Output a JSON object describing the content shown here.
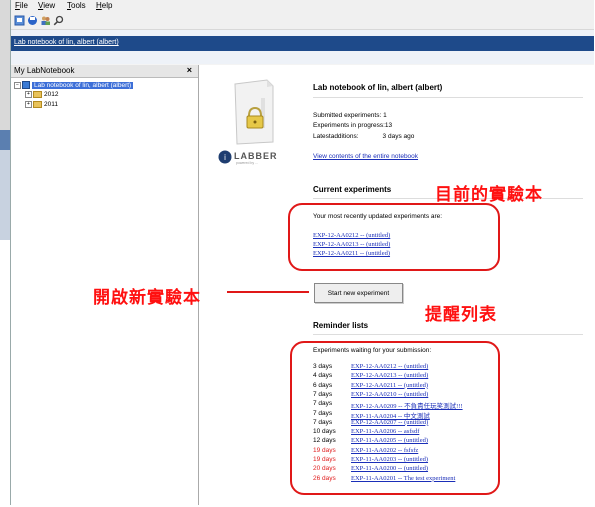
{
  "menu": [
    "File",
    "View",
    "Tools",
    "Help"
  ],
  "toolbar_icons": [
    "new-icon",
    "save-icon",
    "users-icon",
    "search-icon"
  ],
  "breadcrumb": "Lab notebook of lin, albert (albert)",
  "left_panel": {
    "title": "My LabNotebook",
    "close": "×",
    "tree": {
      "root": "Lab notebook of lin, albert (albert)",
      "children": [
        "2012",
        "2011"
      ]
    }
  },
  "main": {
    "title": "Lab notebook of lin, albert (albert)",
    "logo_text": "LABBER",
    "logo_sub": "powered by ...",
    "stats": [
      {
        "label": "Submitted experiments:",
        "value": "1"
      },
      {
        "label": "Experiments in progress:",
        "value": "13"
      },
      {
        "label": "Latestadditions:",
        "value": "3 days ago"
      }
    ],
    "view_link": "View contents of the entire notebook",
    "current": {
      "heading": "Current experiments",
      "intro": "Your most recently updated experiments are:",
      "items": [
        "EXP-12-AA0212 -- (untitled)",
        "EXP-12-AA0213 -- (untitled)",
        "EXP-12-AA0211 -- (untitled)"
      ]
    },
    "start_button": "Start new experiment",
    "reminder": {
      "heading": "Reminder lists",
      "intro": "Experiments waiting for your submission:",
      "items": [
        {
          "days": "3 days",
          "link": "EXP-12-AA0212 -- (untitled)",
          "overdue": false
        },
        {
          "days": "4 days",
          "link": "EXP-12-AA0213 -- (untitled)",
          "overdue": false
        },
        {
          "days": "6 days",
          "link": "EXP-12-AA0211 -- (untitled)",
          "overdue": false
        },
        {
          "days": "7 days",
          "link": "EXP-12-AA0210 -- (untitled)",
          "overdue": false
        },
        {
          "days": "7 days",
          "link": "EXP-12-AA0209 -- 不負責任玩笑測試!!!",
          "overdue": false
        },
        {
          "days": "7 days",
          "link": "EXP-11-AA0204 -- 中文測試",
          "overdue": false
        },
        {
          "days": "7 days",
          "link": "EXP-12-AA0207 -- (untitled)",
          "overdue": false
        },
        {
          "days": "10 days",
          "link": "EXP-11-AA0206 -- asfsdf",
          "overdue": false
        },
        {
          "days": "12 days",
          "link": "EXP-11-AA0205 -- (untitled)",
          "overdue": false
        },
        {
          "days": "19 days",
          "link": "EXP-11-AA0202 -- fsfsfz",
          "overdue": true
        },
        {
          "days": "19 days",
          "link": "EXP-11-AA0203 -- (untitled)",
          "overdue": true
        },
        {
          "days": "20 days",
          "link": "EXP-11-AA0200 -- (untitled)",
          "overdue": true
        },
        {
          "days": "26 days",
          "link": "EXP-11-AA0201 -- The test experiment",
          "overdue": true
        }
      ]
    }
  },
  "annotations": {
    "current": "目前的實驗本",
    "new": "開啟新實驗本",
    "reminder": "提醒列表"
  },
  "colors": {
    "annotation": "#ff1010",
    "link": "#1a2eb8",
    "overdue": "#e02020",
    "header_bar": "#1e4a8a"
  }
}
